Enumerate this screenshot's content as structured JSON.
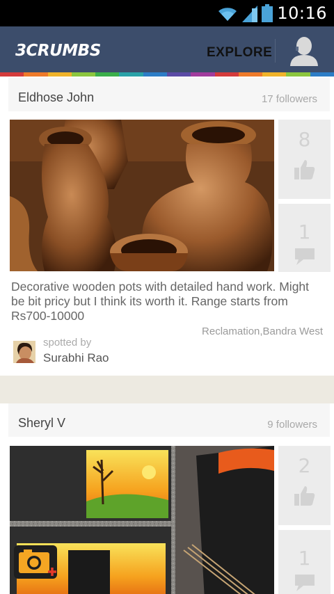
{
  "status_bar": {
    "time": "10:16",
    "icons": [
      "wifi-icon",
      "signal-icon",
      "battery-icon"
    ]
  },
  "app_bar": {
    "logo": "3CRUMBS",
    "explore_label": "EXPLORE",
    "profile_icon": "profile-icon",
    "bg_color": "#3c4d6b"
  },
  "rainbow_colors": [
    "#d43b3b",
    "#ee7a2a",
    "#f0b32a",
    "#8cc63e",
    "#3bae4a",
    "#2aa2a8",
    "#2d7dc6",
    "#5b4ba6",
    "#a13c9d",
    "#d43b3b",
    "#ee7a2a",
    "#f0b32a",
    "#8cc63e",
    "#2d7dc6"
  ],
  "posts": [
    {
      "author": "Eldhose John",
      "followers": "17 followers",
      "likes": "8",
      "comments": "1",
      "description": "Decorative wooden pots with detailed hand work. Might be bit pricy but I think its worth it. Range starts from Rs700-10000",
      "location": "Reclamation,Bandra West",
      "spotted_label": "spotted by",
      "spotter": "Surabhi Rao"
    },
    {
      "author": "Sheryl V",
      "followers": "9 followers",
      "likes": "2",
      "comments": "1"
    }
  ],
  "fab": {
    "icon": "add-photo-camera-icon"
  }
}
